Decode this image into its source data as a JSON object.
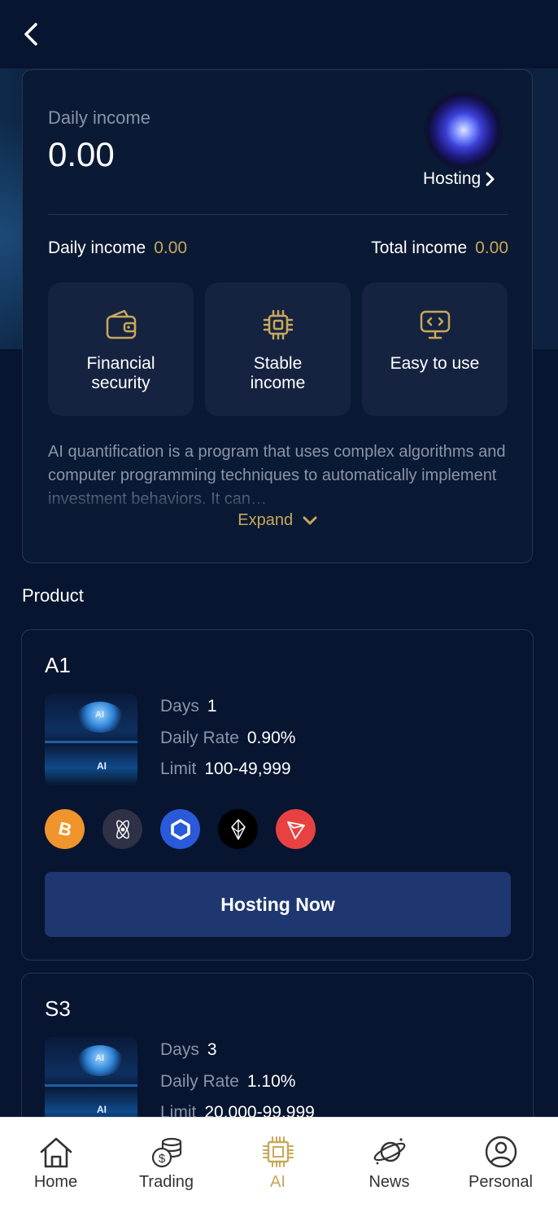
{
  "header": {
    "back_icon": "chevron-left-icon"
  },
  "summary": {
    "daily_income_label": "Daily income",
    "daily_income_value": "0.00",
    "hosting_link_label": "Hosting",
    "stats": {
      "daily_label": "Daily income",
      "daily_value": "0.00",
      "total_label": "Total income",
      "total_value": "0.00"
    },
    "features": [
      {
        "label": "Financial security",
        "icon": "wallet-icon"
      },
      {
        "label": "Stable income",
        "icon": "chip-icon"
      },
      {
        "label": "Easy to use",
        "icon": "monitor-code-icon"
      }
    ],
    "description": "AI quantification is a program that uses complex algorithms and computer programming techniques to automatically implement investment behaviors. It can…",
    "expand_label": "Expand"
  },
  "product_section": {
    "title": "Product",
    "products": [
      {
        "name": "A1",
        "days_label": "Days",
        "days_value": "1",
        "rate_label": "Daily Rate",
        "rate_value": "0.90%",
        "limit_label": "Limit",
        "limit_value": "100-49,999",
        "coins": [
          "bitcoin-icon",
          "cosmos-icon",
          "chainlink-icon",
          "eos-icon",
          "tron-icon"
        ],
        "button_label": "Hosting Now"
      },
      {
        "name": "S3",
        "days_label": "Days",
        "days_value": "3",
        "rate_label": "Daily Rate",
        "rate_value": "1.10%",
        "limit_label": "Limit",
        "limit_value": "20,000-99,999"
      }
    ]
  },
  "tabbar": {
    "items": [
      {
        "label": "Home",
        "icon": "home-icon"
      },
      {
        "label": "Trading",
        "icon": "coins-icon"
      },
      {
        "label": "AI",
        "icon": "ai-chip-icon",
        "active": true
      },
      {
        "label": "News",
        "icon": "planet-icon"
      },
      {
        "label": "Personal",
        "icon": "user-icon"
      }
    ]
  },
  "colors": {
    "background": "#071530",
    "card_border": "#2a3550",
    "tile": "#152340",
    "accent_gold": "#c9a75a",
    "button": "#1e3770"
  }
}
